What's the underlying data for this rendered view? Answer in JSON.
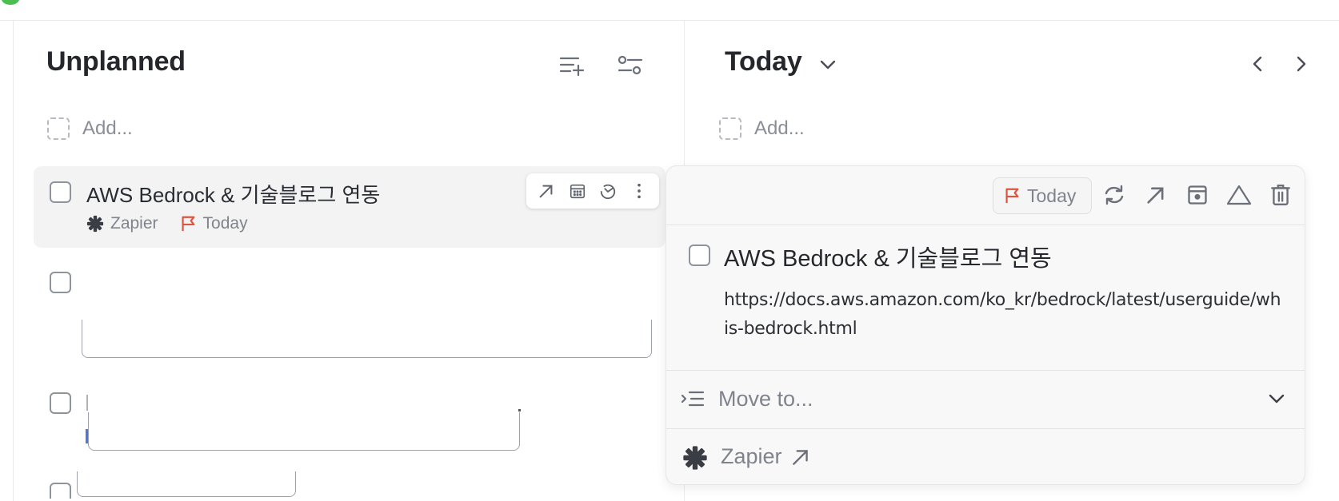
{
  "colors": {
    "accent_flag": "#e0533d",
    "zapier_icon": "#3a3d44",
    "window_dot": "#4cbf52"
  },
  "unplanned": {
    "title": "Unplanned",
    "add_placeholder": "Add...",
    "tasks": [
      {
        "title": "AWS Bedrock & 기술블로그 연동",
        "source": "Zapier",
        "due": "Today"
      }
    ]
  },
  "today": {
    "title": "Today",
    "add_placeholder": "Add..."
  },
  "detail": {
    "due_pill": "Today",
    "title": "AWS Bedrock & 기술블로그 연동",
    "note_line1": "https://docs.aws.amazon.com/ko_kr/bedrock/latest/userguide/wh",
    "note_line2": "is-bedrock.html",
    "move_to": "Move to...",
    "integration": "Zapier"
  },
  "icons": {
    "unplanned_add_list": "list-add-icon",
    "unplanned_filter": "filter-sliders-icon",
    "today_dropdown": "chevron-down-icon",
    "today_prev": "chevron-left-icon",
    "today_next": "chevron-right-icon",
    "task_open": "arrow-up-right-icon",
    "task_calendar": "calendar-icon",
    "task_timer": "timer-icon",
    "task_more": "more-vertical-icon",
    "panel_repeat": "repeat-icon",
    "panel_open": "arrow-up-right-icon",
    "panel_archive": "archive-box-icon",
    "panel_priority": "triangle-icon",
    "panel_delete": "trash-icon",
    "move_icon": "indent-list-icon",
    "move_chevron": "chevron-down-icon",
    "zapier": "zapier-asterisk-icon",
    "flag": "flag-icon"
  }
}
